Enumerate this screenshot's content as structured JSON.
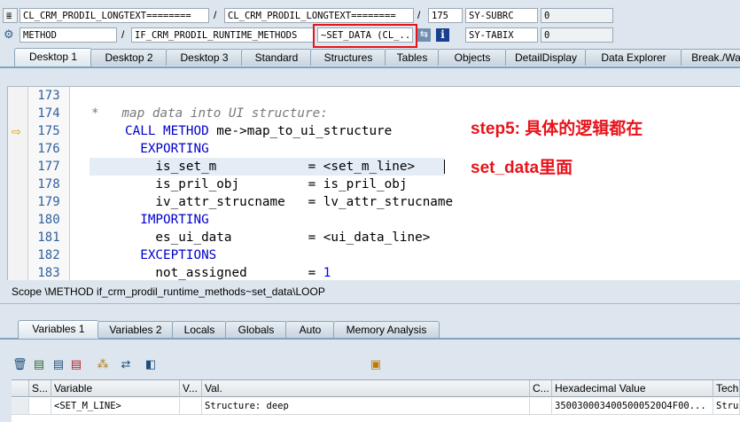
{
  "header": {
    "row1": {
      "program": "CL_CRM_PRODIL_LONGTEXT========",
      "include": "CL_CRM_PRODIL_LONGTEXT========",
      "line": "175",
      "var_name": "SY-SUBRC",
      "var_value": "0"
    },
    "row2": {
      "event_type": "METHOD",
      "event": "IF_CRM_PRODIL_RUNTIME_METHODS",
      "method": "~SET_DATA (CL_...",
      "var_name": "SY-TABIX",
      "var_value": "0"
    },
    "separator": "/"
  },
  "tabs": [
    "Desktop 1",
    "Desktop 2",
    "Desktop 3",
    "Standard",
    "Structures",
    "Tables",
    "Objects",
    "DetailDisplay",
    "Data Explorer",
    "Break./Wa"
  ],
  "editor": {
    "lines": [
      {
        "no": "173",
        "code": ""
      },
      {
        "no": "174",
        "code": "*   map data into UI structure:"
      },
      {
        "no": "175",
        "kw": "CALL METHOD",
        "rest": " me->map_to_ui_structure"
      },
      {
        "no": "176",
        "kw": "  EXPORTING",
        "rest": ""
      },
      {
        "no": "177",
        "code": "    is_set_m            = <set_m_line>"
      },
      {
        "no": "178",
        "code": "    is_pril_obj         = is_pril_obj"
      },
      {
        "no": "179",
        "code": "    iv_attr_strucname   = lv_attr_strucname"
      },
      {
        "no": "180",
        "kw": "  IMPORTING",
        "rest": ""
      },
      {
        "no": "181",
        "code": "    es_ui_data          = <ui_data_line>"
      },
      {
        "no": "182",
        "kw": "  EXCEPTIONS",
        "rest": ""
      },
      {
        "no": "183",
        "code": "    not_assigned        = ",
        "num": "1"
      }
    ],
    "annotation_line1": "step5: 具体的逻辑都在",
    "annotation_line2": "set_data里面"
  },
  "scope": "Scope \\METHOD if_crm_prodil_runtime_methods~set_data\\LOOP",
  "var_tabs": [
    "Variables 1",
    "Variables 2",
    "Locals",
    "Globals",
    "Auto",
    "Memory Analysis"
  ],
  "grid": {
    "headers": [
      "S...",
      "Variable",
      "V...",
      "Val.",
      "C...",
      "Hexadecimal Value",
      "Tech"
    ],
    "row": [
      "",
      "<SET_M_LINE>",
      "",
      "Structure: deep",
      "",
      "3500300034005000520O4F00...",
      "Struc"
    ]
  },
  "colors": {
    "accent_red": "#e8131b",
    "keyword": "#0000cc",
    "comment": "#7a7a7a"
  }
}
